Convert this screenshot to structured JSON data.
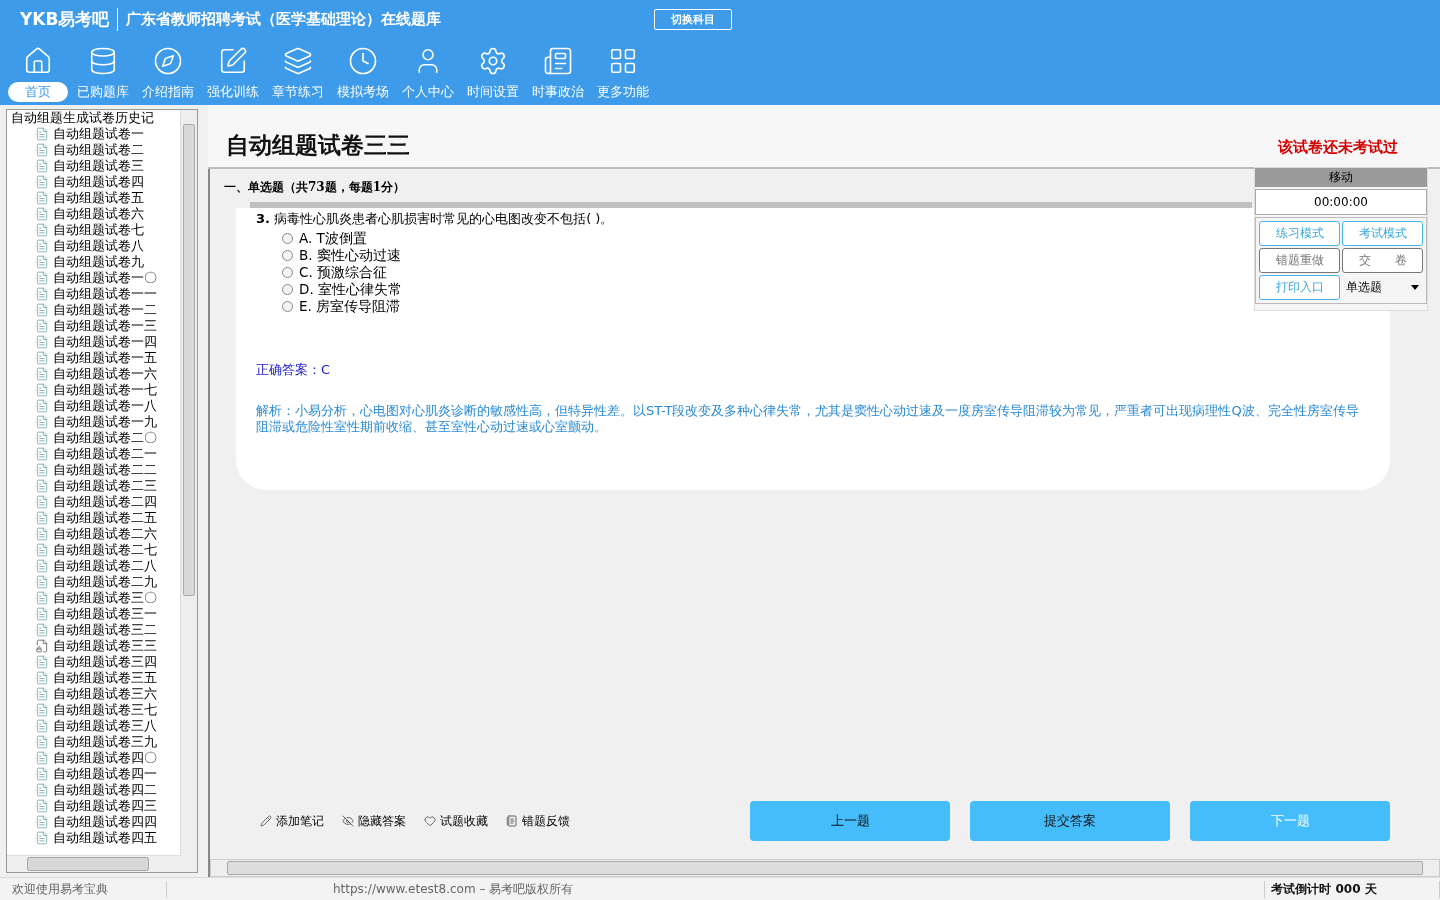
{
  "header": {
    "brand": "YKB易考吧",
    "title": "广东省教师招聘考试（医学基础理论）在线题库",
    "switch_button": "切换科目"
  },
  "nav": [
    {
      "label": "首页",
      "selected": true
    },
    {
      "label": "已购题库",
      "selected": false
    },
    {
      "label": "介绍指南",
      "selected": false
    },
    {
      "label": "强化训练",
      "selected": false
    },
    {
      "label": "章节练习",
      "selected": false
    },
    {
      "label": "模拟考场",
      "selected": false
    },
    {
      "label": "个人中心",
      "selected": false
    },
    {
      "label": "时间设置",
      "selected": false
    },
    {
      "label": "时事政治",
      "selected": false
    },
    {
      "label": "更多功能",
      "selected": false
    }
  ],
  "tree": {
    "label": "自动组题生成试卷历史记",
    "children": [
      {
        "label": "自动组题试卷一",
        "selected": false
      },
      {
        "label": "自动组题试卷二",
        "selected": false
      },
      {
        "label": "自动组题试卷三",
        "selected": false
      },
      {
        "label": "自动组题试卷四",
        "selected": false
      },
      {
        "label": "自动组题试卷五",
        "selected": false
      },
      {
        "label": "自动组题试卷六",
        "selected": false
      },
      {
        "label": "自动组题试卷七",
        "selected": false
      },
      {
        "label": "自动组题试卷八",
        "selected": false
      },
      {
        "label": "自动组题试卷九",
        "selected": false
      },
      {
        "label": "自动组题试卷一〇",
        "selected": false
      },
      {
        "label": "自动组题试卷一一",
        "selected": false
      },
      {
        "label": "自动组题试卷一二",
        "selected": false
      },
      {
        "label": "自动组题试卷一三",
        "selected": false
      },
      {
        "label": "自动组题试卷一四",
        "selected": false
      },
      {
        "label": "自动组题试卷一五",
        "selected": false
      },
      {
        "label": "自动组题试卷一六",
        "selected": false
      },
      {
        "label": "自动组题试卷一七",
        "selected": false
      },
      {
        "label": "自动组题试卷一八",
        "selected": false
      },
      {
        "label": "自动组题试卷一九",
        "selected": false
      },
      {
        "label": "自动组题试卷二〇",
        "selected": false
      },
      {
        "label": "自动组题试卷二一",
        "selected": false
      },
      {
        "label": "自动组题试卷二二",
        "selected": false
      },
      {
        "label": "自动组题试卷二三",
        "selected": false
      },
      {
        "label": "自动组题试卷二四",
        "selected": false
      },
      {
        "label": "自动组题试卷二五",
        "selected": false
      },
      {
        "label": "自动组题试卷二六",
        "selected": false
      },
      {
        "label": "自动组题试卷二七",
        "selected": false
      },
      {
        "label": "自动组题试卷二八",
        "selected": false
      },
      {
        "label": "自动组题试卷二九",
        "selected": false
      },
      {
        "label": "自动组题试卷三〇",
        "selected": false
      },
      {
        "label": "自动组题试卷三一",
        "selected": false
      },
      {
        "label": "自动组题试卷三二",
        "selected": false
      },
      {
        "label": "自动组题试卷三三",
        "selected": true
      },
      {
        "label": "自动组题试卷三四",
        "selected": false
      },
      {
        "label": "自动组题试卷三五",
        "selected": false
      },
      {
        "label": "自动组题试卷三六",
        "selected": false
      },
      {
        "label": "自动组题试卷三七",
        "selected": false
      },
      {
        "label": "自动组题试卷三八",
        "selected": false
      },
      {
        "label": "自动组题试卷三九",
        "selected": false
      },
      {
        "label": "自动组题试卷四〇",
        "selected": false
      },
      {
        "label": "自动组题试卷四一",
        "selected": false
      },
      {
        "label": "自动组题试卷四二",
        "selected": false
      },
      {
        "label": "自动组题试卷四三",
        "selected": false
      },
      {
        "label": "自动组题试卷四四",
        "selected": false
      },
      {
        "label": "自动组题试卷四五",
        "selected": false
      }
    ]
  },
  "paper": {
    "title": "自动组题试卷三三",
    "status": "该试卷还未考试过",
    "section": "一、单选题（共73题，每题1分）",
    "question": {
      "number": "3.",
      "text": "病毒性心肌炎患者心肌损害时常见的心电图改变不包括( )。",
      "options": [
        {
          "letter": "A.",
          "text": "T波倒置",
          "selected": false
        },
        {
          "letter": "B.",
          "text": "窦性心动过速",
          "selected": false
        },
        {
          "letter": "C.",
          "text": "预激综合征",
          "selected": false
        },
        {
          "letter": "D.",
          "text": "室性心律失常",
          "selected": false
        },
        {
          "letter": "E.",
          "text": "房室传导阻滞",
          "selected": false
        }
      ],
      "answer": "正确答案：C",
      "analysis": "解析：小易分析，心电图对心肌炎诊断的敏感性高，但特异性差。以ST-T段改变及多种心律失常，尤其是窦性心动过速及一度房室传导阻滞较为常见，严重者可出现病理性Q波、完全性房室传导阻滞或危险性室性期前收缩、甚至室性心动过速或心室颤动。"
    }
  },
  "control_panel": {
    "title": "移动",
    "timer": "00:00:00",
    "buttons": [
      {
        "label": "练习模式",
        "kind": "accent"
      },
      {
        "label": "考试模式",
        "kind": "accent"
      },
      {
        "label": "错题重做",
        "kind": "plain"
      },
      {
        "label": "交　　卷",
        "kind": "plain"
      },
      {
        "label": "打印入口",
        "kind": "accent"
      }
    ],
    "type_select": "单选题"
  },
  "tools": [
    "添加笔记",
    "隐藏答案",
    "试题收藏",
    "错题反馈"
  ],
  "actions": [
    {
      "label": "上一题",
      "kind": "normal"
    },
    {
      "label": "提交答案",
      "kind": "normal"
    },
    {
      "label": "下一题",
      "kind": "light"
    }
  ],
  "status_bar": {
    "welcome": "欢迎使用易考宝典",
    "copyright": "https://www.etest8.com – 易考吧版权所有",
    "countdown": "考试倒计时 000 天"
  }
}
